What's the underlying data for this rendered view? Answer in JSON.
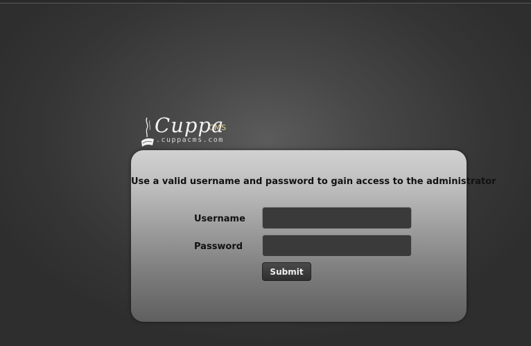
{
  "logo": {
    "brand": "Cuppa",
    "suffix": "CMS",
    "domain": ".cuppacms.com"
  },
  "login": {
    "message": "Use a valid username and password to gain access to the administrator",
    "username_label": "Username",
    "password_label": "Password",
    "username_value": "",
    "password_value": "",
    "submit_label": "Submit"
  },
  "colors": {
    "background": "#3a3a3a",
    "panel_top": "#d1d1d1",
    "panel_bottom": "#5f5f5f",
    "field_bg": "#3a3a3a",
    "button_bg": "#333333",
    "cms_accent": "#e8d7a0"
  }
}
